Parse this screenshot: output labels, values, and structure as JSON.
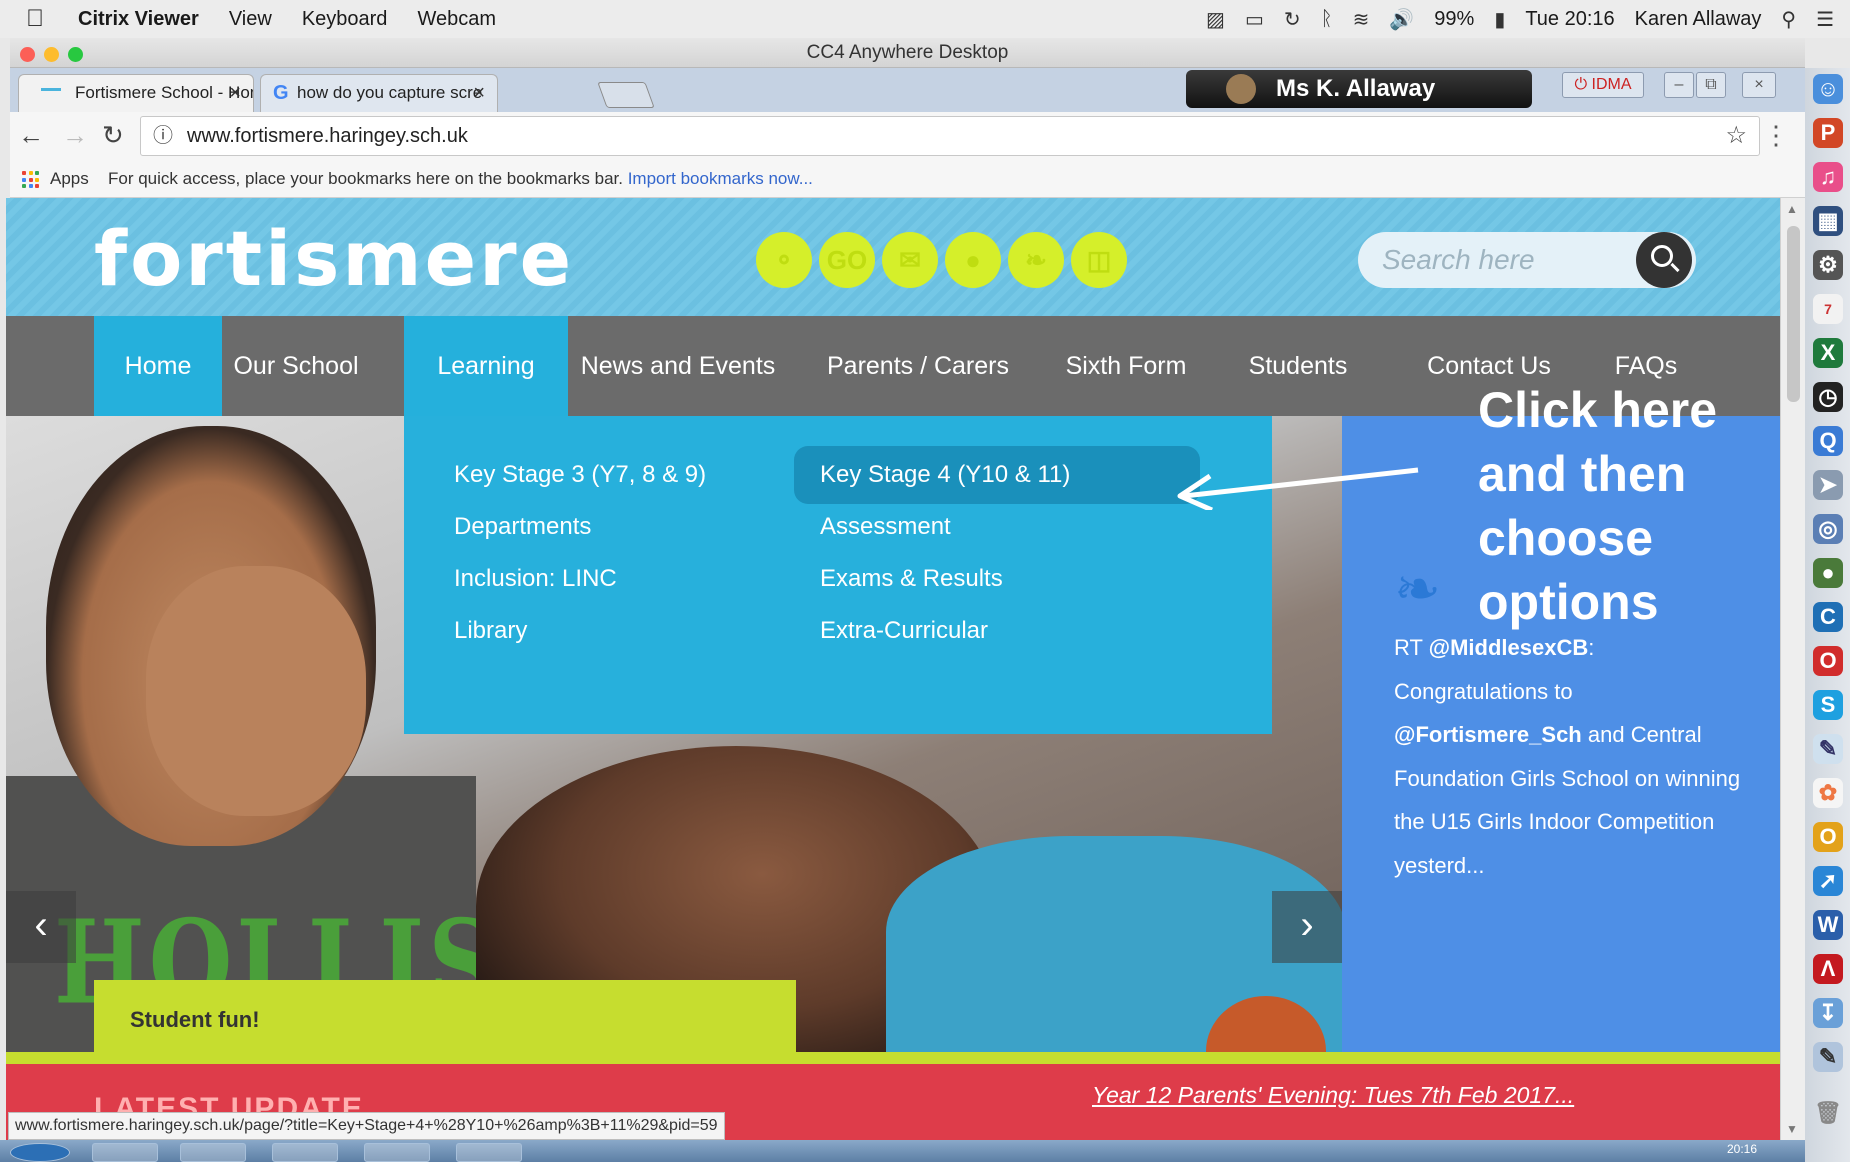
{
  "menubar": {
    "app_name": "Citrix Viewer",
    "menus": [
      "View",
      "Keyboard",
      "Webcam"
    ],
    "battery": "99%",
    "clock": "Tue 20:16",
    "user": "Karen Allaway"
  },
  "window": {
    "title": "CC4 Anywhere Desktop",
    "user_badge": "Ms K. Allaway",
    "idma_label": "IDMA"
  },
  "tabs": [
    {
      "title": "Fortismere School - Hom",
      "active": true
    },
    {
      "title": "how do you capture scre",
      "active": false
    }
  ],
  "address_bar": {
    "url": "www.fortismere.haringey.sch.uk"
  },
  "bookmarks_bar": {
    "apps_label": "Apps",
    "hint": "For quick access, place your bookmarks here on the bookmarks bar.",
    "import_link": "Import bookmarks now..."
  },
  "site": {
    "logo": "fortismere",
    "header_icons": [
      "globe-icon",
      "go-icon",
      "mail-icon",
      "user-icon",
      "twitter-icon",
      "lock-icon"
    ],
    "go_label": "GO",
    "search_placeholder": "Search here",
    "nav": [
      "Home",
      "Our School",
      "Learning",
      "News and Events",
      "Parents / Carers",
      "Sixth Form",
      "Students",
      "Contact Us",
      "FAQs"
    ],
    "active_nav": "Home",
    "open_nav": "Learning",
    "dropdown": {
      "left": [
        "Key Stage 3 (Y7, 8 & 9)",
        "Departments",
        "Inclusion: LINC",
        "Library"
      ],
      "right": [
        "Key Stage 4 (Y10 & 11)",
        "Assessment",
        "Exams & Results",
        "Extra-Curricular"
      ]
    },
    "hero_caption": "Student fun!",
    "hero_shirt_text": "HOLLISTER",
    "tweet": {
      "rt": "RT",
      "handle1": "@MiddlesexCB",
      "after_handle1": ":",
      "line1": "Congratulations to",
      "handle2": "@Fortismere_Sch",
      "rest": "and Central Foundation Girls School on winning the U15 Girls Indoor Competition yesterd..."
    },
    "latest_update": "LATEST UPDATE",
    "news_link": "Year 12 Parents' Evening: Tues 7th Feb 2017..."
  },
  "status_url": "www.fortismere.haringey.sch.uk/page/?title=Key+Stage+4+%28Y10+%26amp%3B+11%29&pid=59",
  "annotation": [
    "Click here",
    "and then",
    "choose",
    "options"
  ],
  "taskbar_clock": "20:16",
  "colors": {
    "header_blue": "#74c7e6",
    "nav_gray": "#6b6b6b",
    "active_blue": "#25b0dc",
    "lime": "#c6dd2f",
    "twitter_panel": "#4e8fe6",
    "news_red": "#de3c4a"
  }
}
